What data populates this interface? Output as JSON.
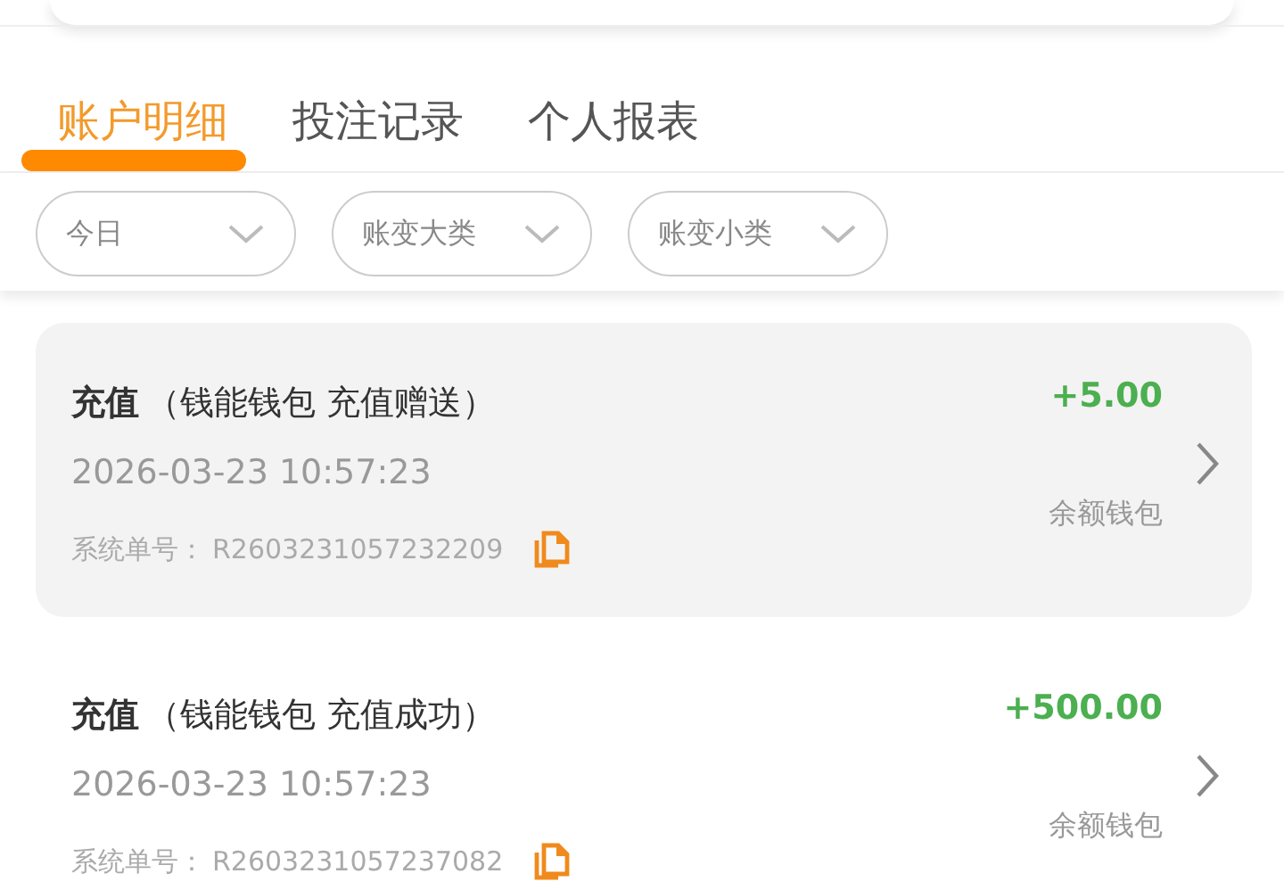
{
  "tabs": [
    {
      "label": "账户明细",
      "selected": true
    },
    {
      "label": "投注记录",
      "selected": false
    },
    {
      "label": "个人报表",
      "selected": false
    }
  ],
  "filters": [
    {
      "label": "今日"
    },
    {
      "label": "账变大类"
    },
    {
      "label": "账变小类"
    }
  ],
  "records": [
    {
      "title": "充值",
      "detail": "（钱能钱包 充值赠送）",
      "time": "2026-03-23 10:57:23",
      "order_label": "系统单号：",
      "order_no": "R2603231057232209",
      "amount": "+5.00",
      "wallet": "余额钱包",
      "selected": true
    },
    {
      "title": "充值",
      "detail": "（钱能钱包 充值成功）",
      "time": "2026-03-23 10:57:23",
      "order_label": "系统单号：",
      "order_no": "R2603231057237082",
      "amount": "+500.00",
      "wallet": "余额钱包",
      "selected": false
    }
  ]
}
